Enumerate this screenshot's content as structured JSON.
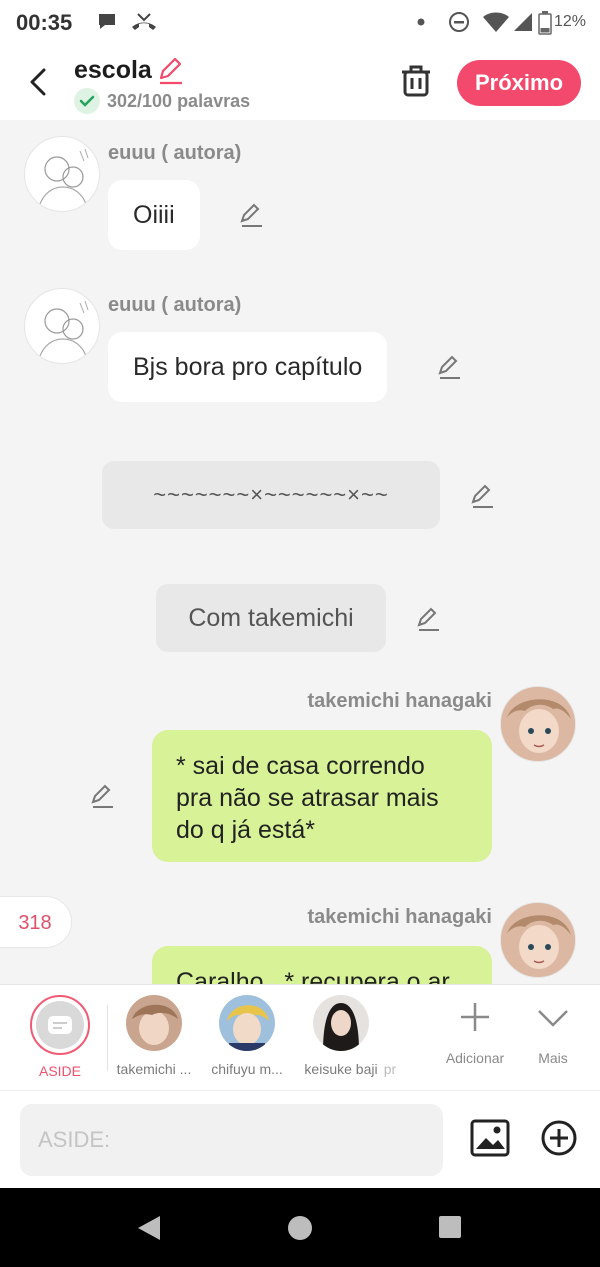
{
  "status_bar": {
    "time": "00:35",
    "battery": "12%"
  },
  "header": {
    "title": "escola",
    "word_count": "302/100 palavras",
    "next_label": "Próximo"
  },
  "messages": [
    {
      "type": "left",
      "name": "euuu ( autora)",
      "text": "Oiiii"
    },
    {
      "type": "left",
      "name": "euuu ( autora)",
      "text": "Bjs bora pro capítulo"
    },
    {
      "type": "narration",
      "text": "~~~~~~~×~~~~~~×~~"
    },
    {
      "type": "narration",
      "text": "Com takemichi"
    },
    {
      "type": "right",
      "name": "takemichi hanagaki",
      "text_lines": [
        "* sai de casa correndo",
        "pra não se atrasar mais",
        "do q já está*"
      ]
    },
    {
      "type": "right",
      "name": "takemichi hanagaki",
      "text": "Caralho.. * recupera o ar"
    }
  ],
  "counter_badge": "318",
  "characters": {
    "aside_label": "ASIDE",
    "items": [
      "takemichi ...",
      "chifuyu m...",
      "keisuke baji",
      "pr"
    ],
    "add_label": "Adicionar",
    "more_label": "Mais"
  },
  "input": {
    "placeholder": "ASIDE:"
  },
  "colors": {
    "accent": "#f2496c",
    "bubble_green": "#d7f297",
    "background": "#f4f4f5"
  },
  "icons": [
    "chat-icon",
    "missed-call-icon",
    "dnd-icon",
    "wifi-icon",
    "signal-icon",
    "battery-icon",
    "back-icon",
    "pencil-icon",
    "check-icon",
    "trash-icon",
    "image-icon",
    "plus-circle-icon",
    "plus-icon",
    "chevron-down-icon"
  ]
}
